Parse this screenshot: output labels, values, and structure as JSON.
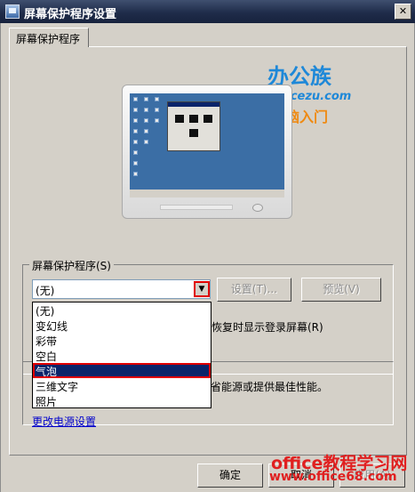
{
  "window": {
    "title": "屏幕保护程序设置",
    "close_glyph": "✕"
  },
  "tab": {
    "label": "屏幕保护程序"
  },
  "logo": {
    "top": "办公族",
    "url": "Officezu.com",
    "bottom": "电脑入门"
  },
  "screensaver": {
    "group_label": "屏幕保护程序(S)",
    "selected": "(无)",
    "settings_label": "设置(T)...",
    "preview_label": "预览(V)",
    "resume_text": "恢复时显示登录屏幕(R)",
    "options": [
      "(无)",
      "变幻线",
      "彩带",
      "空白",
      "气泡",
      "三维文字",
      "照片"
    ],
    "highlighted_option": "气泡"
  },
  "power": {
    "description": "省能源或提供最佳性能。",
    "link": "更改电源设置"
  },
  "buttons": {
    "ok": "确定",
    "cancel": "取消",
    "apply": "应用(A)"
  },
  "watermark": {
    "line1": "office教程学习网",
    "line2": "www.office68.com"
  },
  "colors": {
    "title_bar": "#1f2c4a",
    "selection": "#0a246a",
    "highlight_border": "#e00000",
    "desktop": "#3b6ea5"
  }
}
